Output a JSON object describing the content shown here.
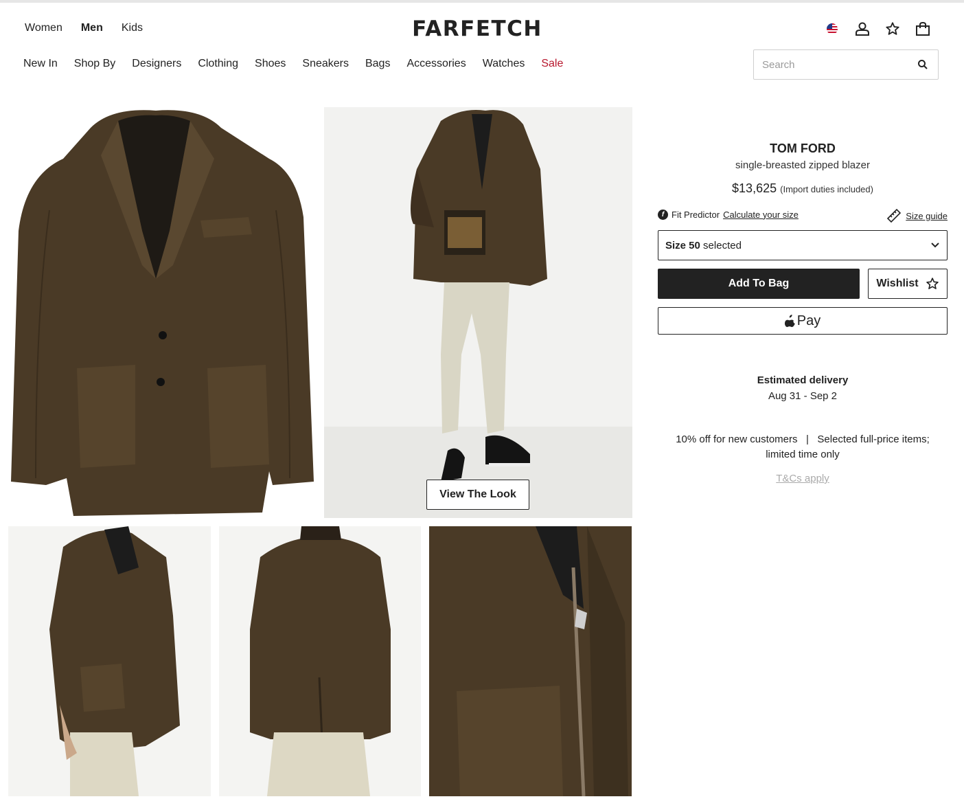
{
  "departments": [
    "Women",
    "Men",
    "Kids"
  ],
  "logo": "FARFETCH",
  "header_icons": [
    "us-flag-icon",
    "account-icon",
    "wishlist-star-icon",
    "shopping-bag-icon"
  ],
  "categories": [
    "New In",
    "Shop By",
    "Designers",
    "Clothing",
    "Shoes",
    "Sneakers",
    "Bags",
    "Accessories",
    "Watches",
    "Sale"
  ],
  "search": {
    "placeholder": "Search"
  },
  "gallery": {
    "view_the_look": "View The Look"
  },
  "product": {
    "brand": "TOM FORD",
    "name": "single-breasted zipped blazer",
    "price": "$13,625",
    "duty_note": "(Import duties included)",
    "fit_predictor_label": "Fit Predictor",
    "fit_predictor_link": "Calculate your size",
    "size_guide": "Size guide",
    "size_label": "Size 50",
    "size_state": "selected",
    "add_to_bag": "Add To Bag",
    "wishlist": "Wishlist",
    "apple_pay": "Pay"
  },
  "delivery": {
    "label": "Estimated delivery",
    "dates": "Aug 31 - Sep 2"
  },
  "promo": {
    "line1": "10% off for new customers   |   Selected full-price items;",
    "line2": "limited time only",
    "terms": "T&Cs apply"
  },
  "colors": {
    "sale_red": "#b7162c",
    "suede_brown": "#4a3a26",
    "button_dark": "#222222"
  }
}
